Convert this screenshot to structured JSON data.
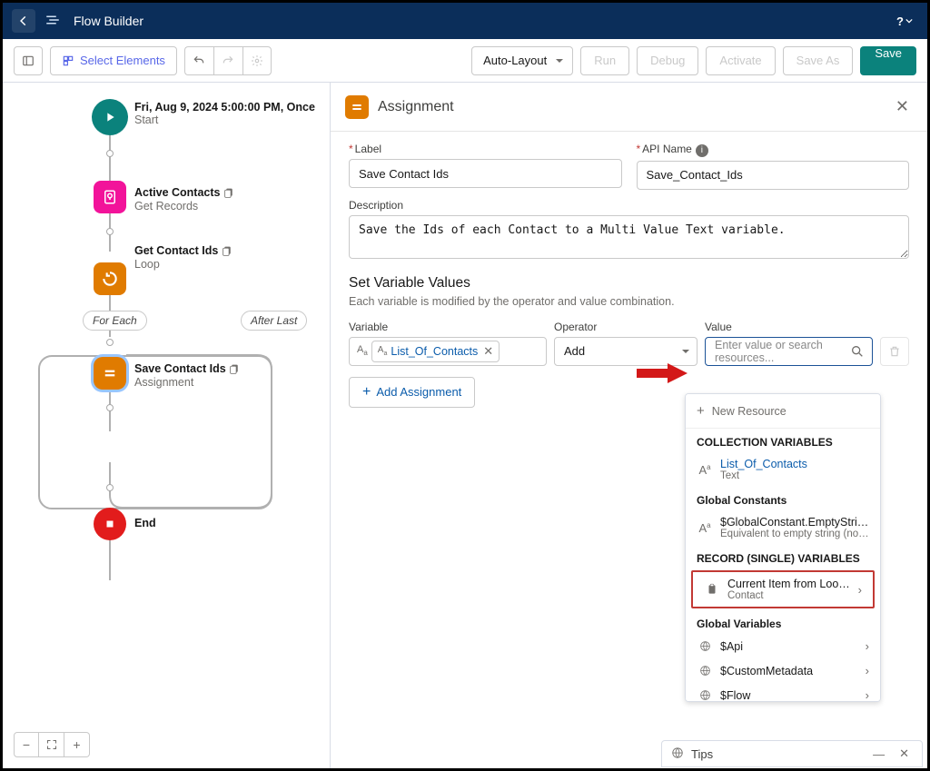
{
  "topbar": {
    "title": "Flow Builder",
    "help": "?"
  },
  "toolbar": {
    "select_elements": "Select Elements",
    "layout_mode": "Auto-Layout",
    "run": "Run",
    "debug": "Debug",
    "activate": "Activate",
    "save_as": "Save As",
    "save": "Save"
  },
  "canvas": {
    "start": {
      "title": "Fri, Aug 9, 2024 5:00:00 PM, Once",
      "sub": "Start"
    },
    "get": {
      "title": "Active Contacts",
      "sub": "Get Records"
    },
    "loop": {
      "title": "Get Contact Ids",
      "sub": "Loop"
    },
    "branch_for_each": "For Each",
    "branch_after_last": "After Last",
    "assign": {
      "title": "Save Contact Ids",
      "sub": "Assignment"
    },
    "end": {
      "title": "End"
    }
  },
  "panel": {
    "title": "Assignment",
    "label_field": "Label",
    "label_value": "Save Contact Ids",
    "api_field": "API Name",
    "api_value": "Save_Contact_Ids",
    "desc_field": "Description",
    "desc_value": "Save the Ids of each Contact to a Multi Value Text variable.",
    "section_title": "Set Variable Values",
    "section_sub": "Each variable is modified by the operator and value combination.",
    "col_variable": "Variable",
    "col_operator": "Operator",
    "col_value": "Value",
    "variable_pill": "List_Of_Contacts",
    "operator_value": "Add",
    "value_placeholder": "Enter value or search resources...",
    "add_assignment": "Add Assignment"
  },
  "dropdown": {
    "new_resource": "New Resource",
    "sec_collection": "COLLECTION VARIABLES",
    "item_list": {
      "title": "List_Of_Contacts",
      "sub": "Text"
    },
    "sec_global_const": "Global Constants",
    "item_empty": {
      "title": "$GlobalConstant.EmptyString",
      "sub": "Equivalent to empty string (not n..."
    },
    "sec_record_single": "RECORD (SINGLE) VARIABLES",
    "item_current": {
      "title": "Current Item from Loop Ge...",
      "sub": "Contact"
    },
    "sec_global_vars": "Global Variables",
    "item_api": "$Api",
    "item_custom": "$CustomMetadata",
    "item_flow": "$Flow"
  },
  "tips": {
    "label": "Tips"
  }
}
